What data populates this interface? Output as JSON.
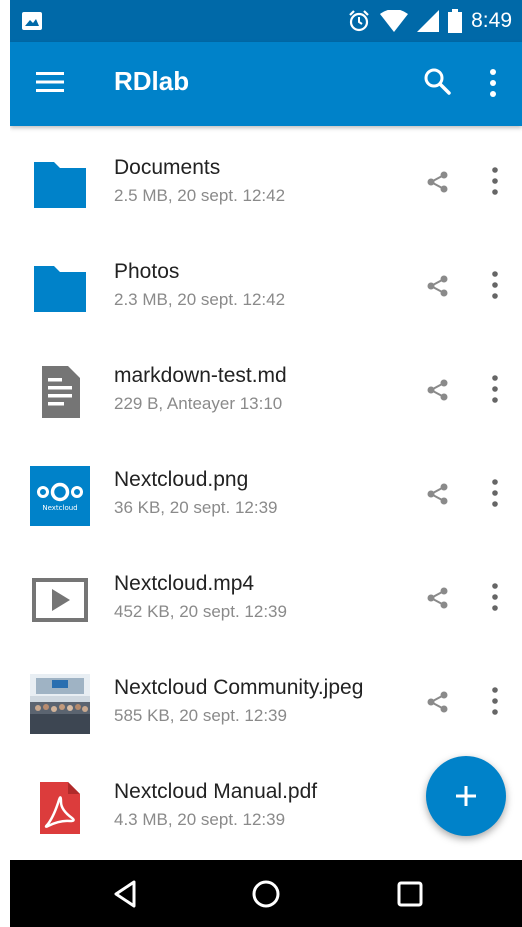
{
  "status_bar": {
    "time": "8:49",
    "icons": [
      "image-notification-icon",
      "alarm-icon",
      "wifi-icon",
      "signal-icon",
      "battery-icon"
    ]
  },
  "app_bar": {
    "title": "RDlab",
    "icons": [
      "menu-icon",
      "search-icon",
      "overflow-menu-icon"
    ]
  },
  "files": [
    {
      "name": "Documents",
      "meta": "2.5 MB, 20 sept. 12:42",
      "icon": "folder-icon"
    },
    {
      "name": "Photos",
      "meta": "2.3 MB, 20 sept. 12:42",
      "icon": "folder-icon"
    },
    {
      "name": "markdown-test.md",
      "meta": "229 B, Anteayer 13:10",
      "icon": "text-file-icon"
    },
    {
      "name": "Nextcloud.png",
      "meta": "36 KB, 20 sept. 12:39",
      "icon": "image-thumbnail"
    },
    {
      "name": "Nextcloud.mp4",
      "meta": "452 KB, 20 sept. 12:39",
      "icon": "video-file-icon"
    },
    {
      "name": "Nextcloud Community.jpeg",
      "meta": "585 KB, 20 sept. 12:39",
      "icon": "photo-thumbnail"
    },
    {
      "name": "Nextcloud Manual.pdf",
      "meta": "4.3 MB, 20 sept. 12:39",
      "icon": "pdf-file-icon"
    }
  ],
  "thumbnail_text": {
    "nextcloud_logo": "Nextcloud"
  },
  "colors": {
    "status_bar": "#0069a8",
    "app_bar": "#0082c9",
    "folder": "#0082c9",
    "fab": "#0082c9",
    "pdf": "#dc3c3c",
    "meta_text": "#8a8a8a",
    "file_icon_gray": "#757575"
  }
}
